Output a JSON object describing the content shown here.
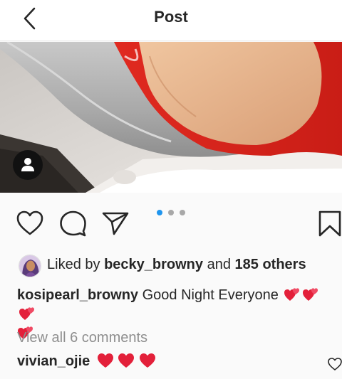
{
  "header": {
    "title": "Post"
  },
  "colors": {
    "accent_dot": "#1f95ee",
    "heart_emoji": "#e3203a",
    "muted_text": "#8e8e8e"
  },
  "carousel": {
    "count": 3,
    "active_index": 0
  },
  "likes": {
    "prefix": "Liked by",
    "user": "becky_browny",
    "and": "and",
    "others": "185 others"
  },
  "caption": {
    "username": "kosipearl_browny",
    "text": "Good Night Everyone"
  },
  "comments": {
    "view_all": "View all 6 comments",
    "items": [
      {
        "username": "vivian_ojie"
      }
    ]
  },
  "icons": {
    "back": "chevron-left-icon",
    "like": "heart-outline-icon",
    "comment": "comment-bubble-icon",
    "share": "paper-plane-icon",
    "save": "bookmark-icon",
    "user_tag": "person-icon"
  }
}
